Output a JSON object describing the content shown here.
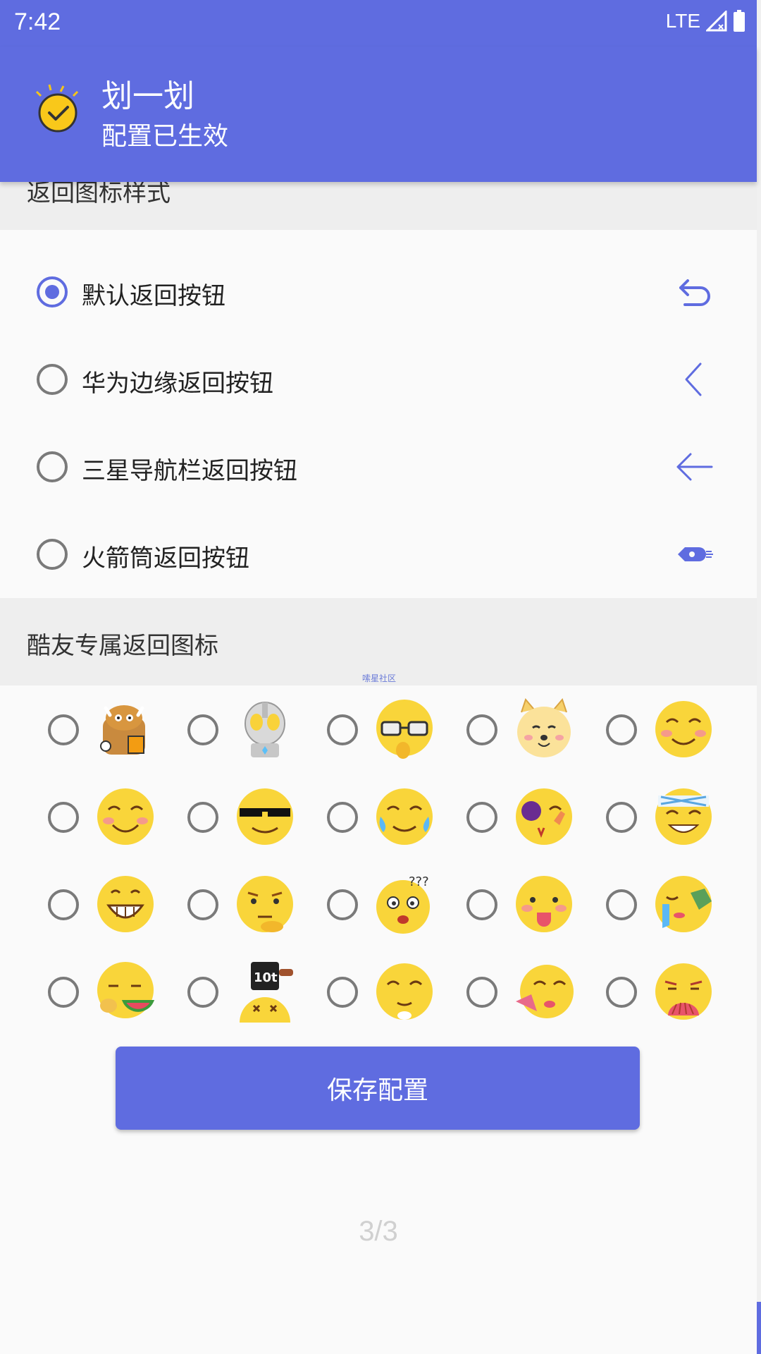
{
  "status_bar": {
    "time": "7:42",
    "network": "LTE"
  },
  "app_bar": {
    "title": "划一划",
    "subtitle": "配置已生效"
  },
  "sections": {
    "back_icon_style": "返回图标样式",
    "kuyou_icons": "酷友专属返回图标"
  },
  "back_options": [
    {
      "label": "默认返回按钮",
      "selected": true,
      "icon": "undo-arrow-icon"
    },
    {
      "label": "华为边缘返回按钮",
      "selected": false,
      "icon": "chevron-left-icon"
    },
    {
      "label": "三星导航栏返回按钮",
      "selected": false,
      "icon": "arrow-left-icon"
    },
    {
      "label": "火箭筒返回按钮",
      "selected": false,
      "icon": "rocket-launcher-icon"
    }
  ],
  "emoji_options": [
    "cow-thumbs-up-emoji",
    "ultraman-emoji",
    "sunglasses-smirk-emoji",
    "doge-emoji",
    "squint-smile-emoji",
    "shy-smile-emoji",
    "deal-with-it-emoji",
    "laugh-cry-emoji",
    "bruised-wave-emoji",
    "bandana-laugh-emoji",
    "grin-teeth-emoji",
    "skeptical-emoji",
    "confused-emoji",
    "tongue-out-emoji",
    "cry-wipe-emoji",
    "eating-watermelon-emoji",
    "ten-ton-weight-emoji",
    "sneaky-eat-emoji",
    "fan-wave-emoji",
    "fan-cover-emoji"
  ],
  "save_button": "保存配置",
  "pager": "3/3",
  "watermark": "嗦星社区",
  "colors": {
    "primary": "#5f6ce0",
    "face_yellow": "#f9d53a"
  }
}
